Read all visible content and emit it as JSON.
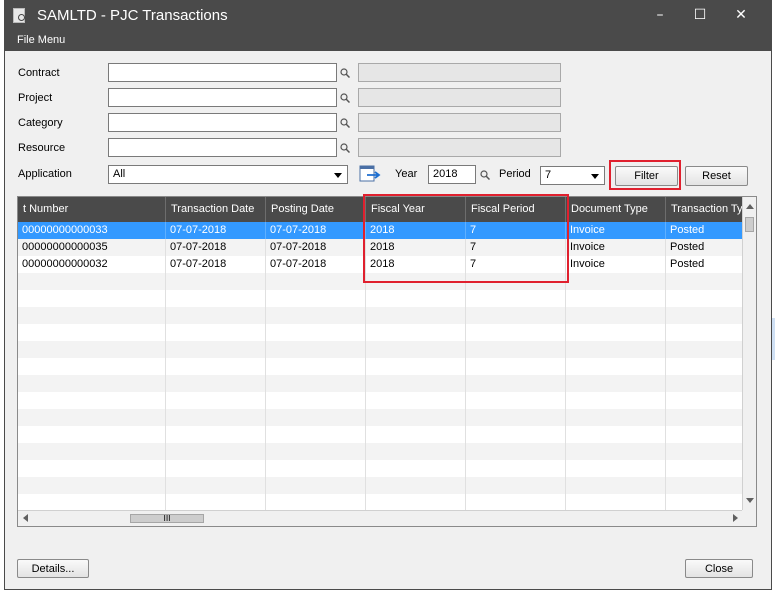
{
  "window": {
    "title": "SAMLTD - PJC Transactions",
    "controls": {
      "minimize": "–",
      "maximize": "☐",
      "close": "✕"
    }
  },
  "menu": {
    "file": "File Menu"
  },
  "filters": {
    "contract_label": "Contract",
    "project_label": "Project",
    "category_label": "Category",
    "resource_label": "Resource",
    "application_label": "Application",
    "application_value": "All",
    "year_label": "Year",
    "year_value": "2018",
    "period_label": "Period",
    "period_value": "7",
    "filter_button": "Filter",
    "reset_button": "Reset"
  },
  "grid": {
    "columns": [
      "t Number",
      "Transaction Date",
      "Posting Date",
      "Fiscal Year",
      "Fiscal Period",
      "Document Type",
      "Transaction Ty"
    ],
    "rows": [
      [
        "00000000000033",
        "07-07-2018",
        "07-07-2018",
        "2018",
        "7",
        "Invoice",
        "Posted"
      ],
      [
        "00000000000035",
        "07-07-2018",
        "07-07-2018",
        "2018",
        "7",
        "Invoice",
        "Posted"
      ],
      [
        "00000000000032",
        "07-07-2018",
        "07-07-2018",
        "2018",
        "7",
        "Invoice",
        "Posted"
      ]
    ],
    "selected_row": 0,
    "hscroll_grip": "III"
  },
  "footer": {
    "details_button": "Details...",
    "close_button": "Close"
  },
  "colors": {
    "titlebar": "#4a4a4a",
    "selection": "#3399ff",
    "highlight": "#e0202e"
  }
}
